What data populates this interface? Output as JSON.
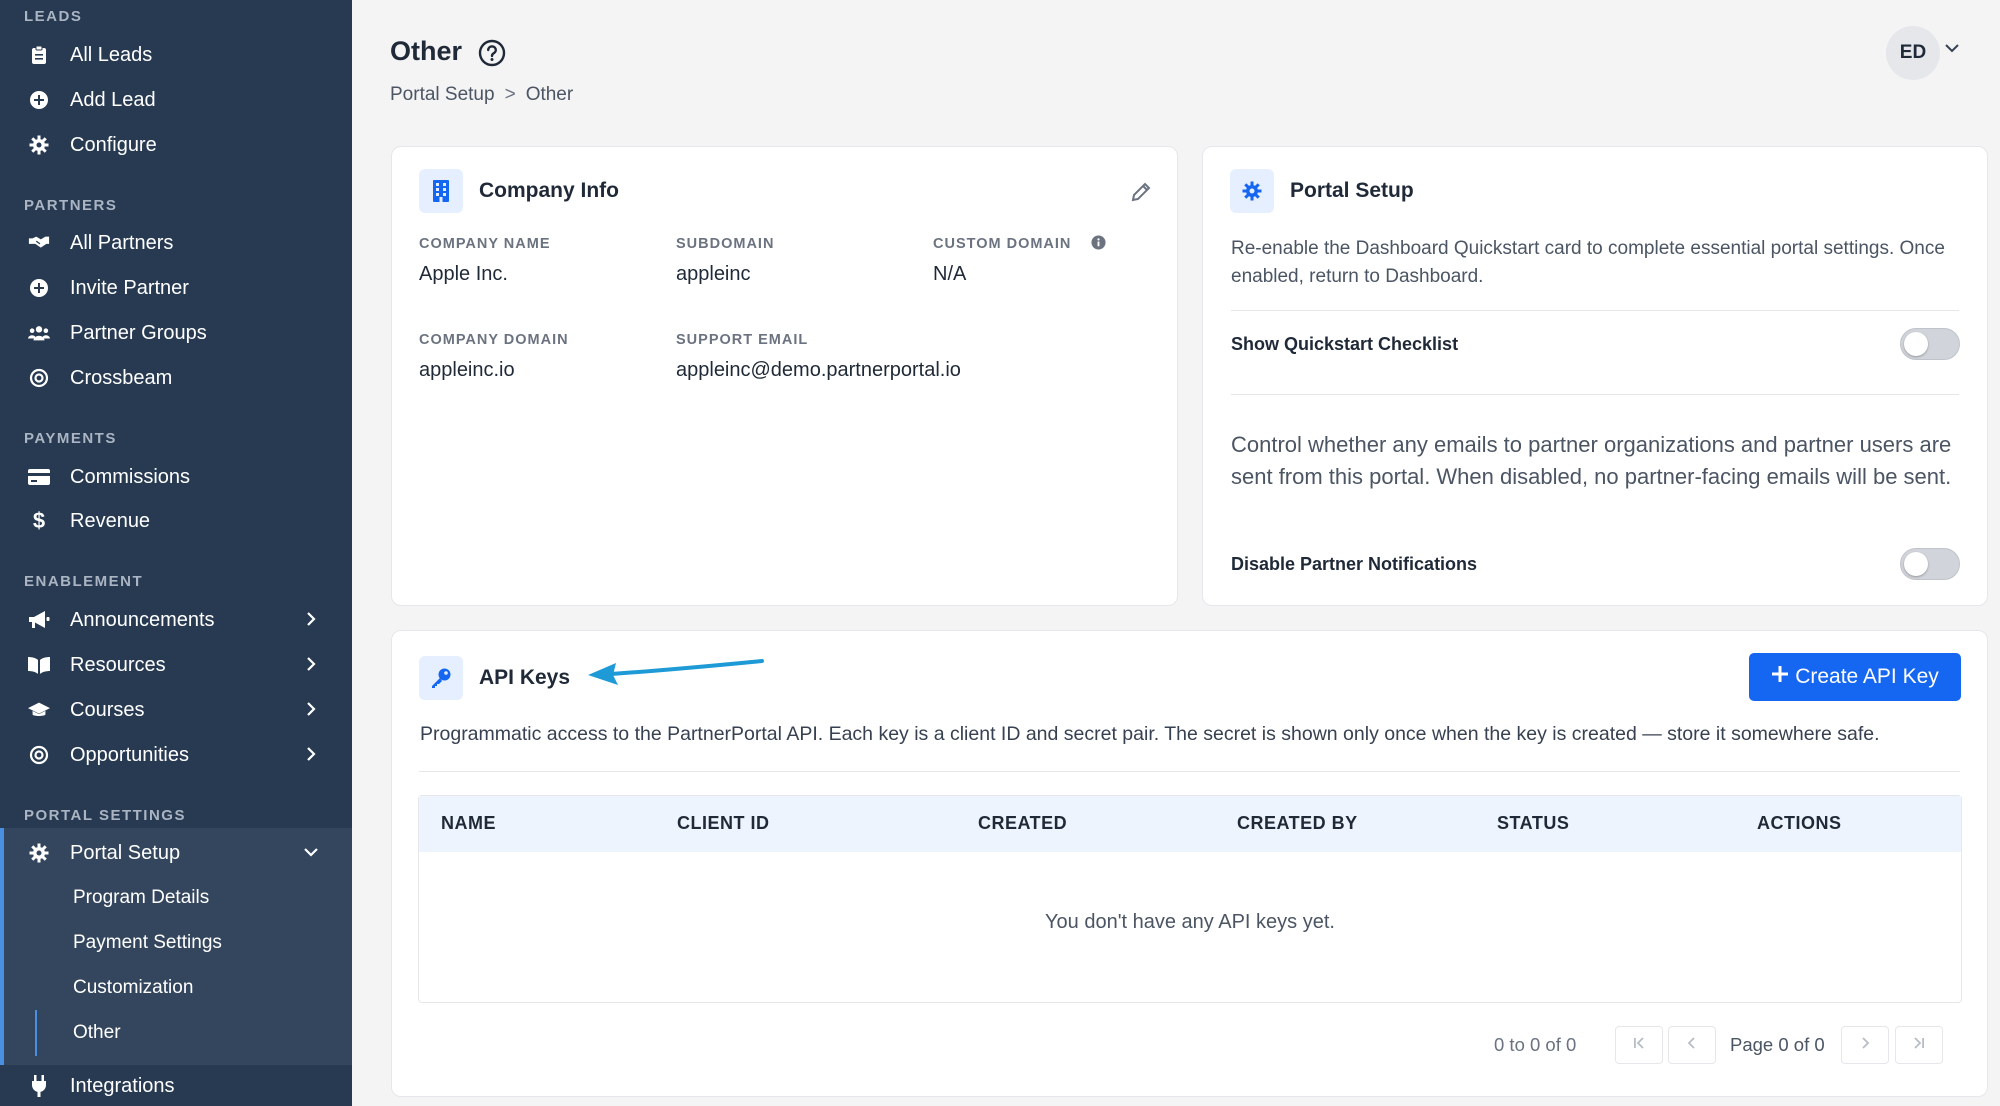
{
  "sidebar": {
    "sections": {
      "leads": "LEADS",
      "partners": "PARTNERS",
      "payments": "PAYMENTS",
      "enablement": "ENABLEMENT",
      "portal_settings": "PORTAL SETTINGS"
    },
    "items": {
      "all_leads": "All Leads",
      "add_lead": "Add Lead",
      "configure": "Configure",
      "all_partners": "All Partners",
      "invite_partner": "Invite Partner",
      "partner_groups": "Partner Groups",
      "crossbeam": "Crossbeam",
      "commissions": "Commissions",
      "revenue": "Revenue",
      "announcements": "Announcements",
      "resources": "Resources",
      "courses": "Courses",
      "opportunities": "Opportunities",
      "portal_setup": "Portal Setup",
      "integrations": "Integrations"
    },
    "subitems": {
      "program_details": "Program Details",
      "payment_settings": "Payment Settings",
      "customization": "Customization",
      "other": "Other"
    }
  },
  "header": {
    "title": "Other",
    "breadcrumb": [
      "Portal Setup",
      ">",
      "Other"
    ],
    "avatar_initials": "ED"
  },
  "company_info": {
    "title": "Company Info",
    "fields": {
      "company_name_label": "COMPANY NAME",
      "company_name": "Apple Inc.",
      "subdomain_label": "SUBDOMAIN",
      "subdomain": "appleinc",
      "custom_domain_label": "CUSTOM DOMAIN",
      "custom_domain": "N/A",
      "company_domain_label": "COMPANY DOMAIN",
      "company_domain": "appleinc.io",
      "support_email_label": "SUPPORT EMAIL",
      "support_email": "appleinc@demo.partnerportal.io"
    }
  },
  "portal_setup": {
    "title": "Portal Setup",
    "quickstart_desc": "Re-enable the Dashboard Quickstart card to complete essential portal settings. Once enabled, return to Dashboard.",
    "quickstart_label": "Show Quickstart Checklist",
    "quickstart_on": false,
    "notifications_desc": "Control whether any emails to partner organizations and partner users are sent from this portal. When disabled, no partner-facing emails will be sent.",
    "notifications_label": "Disable Partner Notifications",
    "notifications_on": false
  },
  "api_keys": {
    "title": "API Keys",
    "create_button": "Create API Key",
    "description": "Programmatic access to the PartnerPortal API. Each key is a client ID and secret pair. The secret is shown only once when the key is created — store it somewhere safe.",
    "columns": [
      "NAME",
      "CLIENT ID",
      "CREATED",
      "CREATED BY",
      "STATUS",
      "ACTIONS"
    ],
    "empty_message": "You don't have any API keys yet.",
    "pagination": {
      "range": "0 to 0 of 0",
      "page": "Page 0 of 0"
    }
  },
  "colors": {
    "sidebar_bg": "#273a52",
    "accent": "#1566f0",
    "annotation_arrow": "#1e9ad6"
  }
}
